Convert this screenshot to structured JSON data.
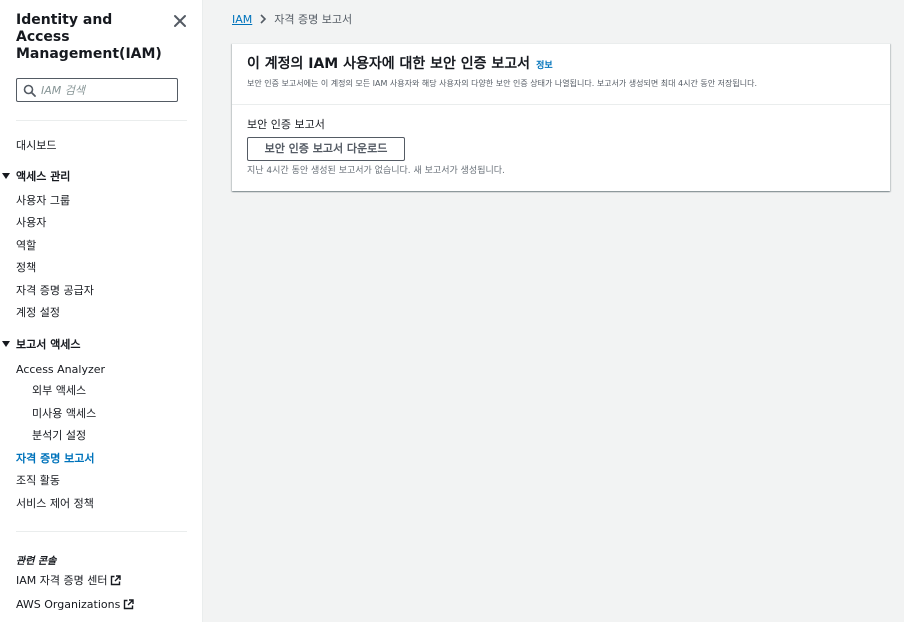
{
  "sidebar": {
    "title": "Identity and Access Management(IAM)",
    "search_placeholder": "IAM 검색",
    "dashboard": "대시보드",
    "access_management": {
      "label": "액세스 관리",
      "items": [
        "사용자 그룹",
        "사용자",
        "역할",
        "정책",
        "자격 증명 공급자",
        "계정 설정"
      ]
    },
    "access_reports": {
      "label": "보고서 액세스",
      "analyzer": "Access Analyzer",
      "analyzer_items": [
        "외부 액세스",
        "미사용 액세스",
        "분석기 설정"
      ],
      "items": [
        "자격 증명 보고서",
        "조직 활동",
        "서비스 제어 정책"
      ],
      "active_item": "자격 증명 보고서"
    },
    "related": {
      "title": "관련 콘솔",
      "items": [
        "IAM 자격 증명 센터",
        "AWS Organizations"
      ]
    }
  },
  "breadcrumb": {
    "root": "IAM",
    "current": "자격 증명 보고서"
  },
  "panel": {
    "title": "이 계정의 IAM 사용자에 대한 보안 인증 보고서",
    "info": "정보",
    "description": "보안 인증 보고서에는 이 계정의 모든 IAM 사용자와 해당 사용자의 다양한 보안 인증 상태가 나열됩니다. 보고서가 생성되면 최대 4시간 동안 저장됩니다.",
    "field_label": "보안 인증 보고서",
    "download_button": "보안 인증 보고서 다운로드",
    "hint": "지난 4시간 동안 생성된 보고서가 없습니다. 새 보고서가 생성됩니다."
  },
  "colors": {
    "link": "#0073bb",
    "text": "#16191f",
    "muted": "#545b64",
    "background": "#f2f3f3"
  }
}
